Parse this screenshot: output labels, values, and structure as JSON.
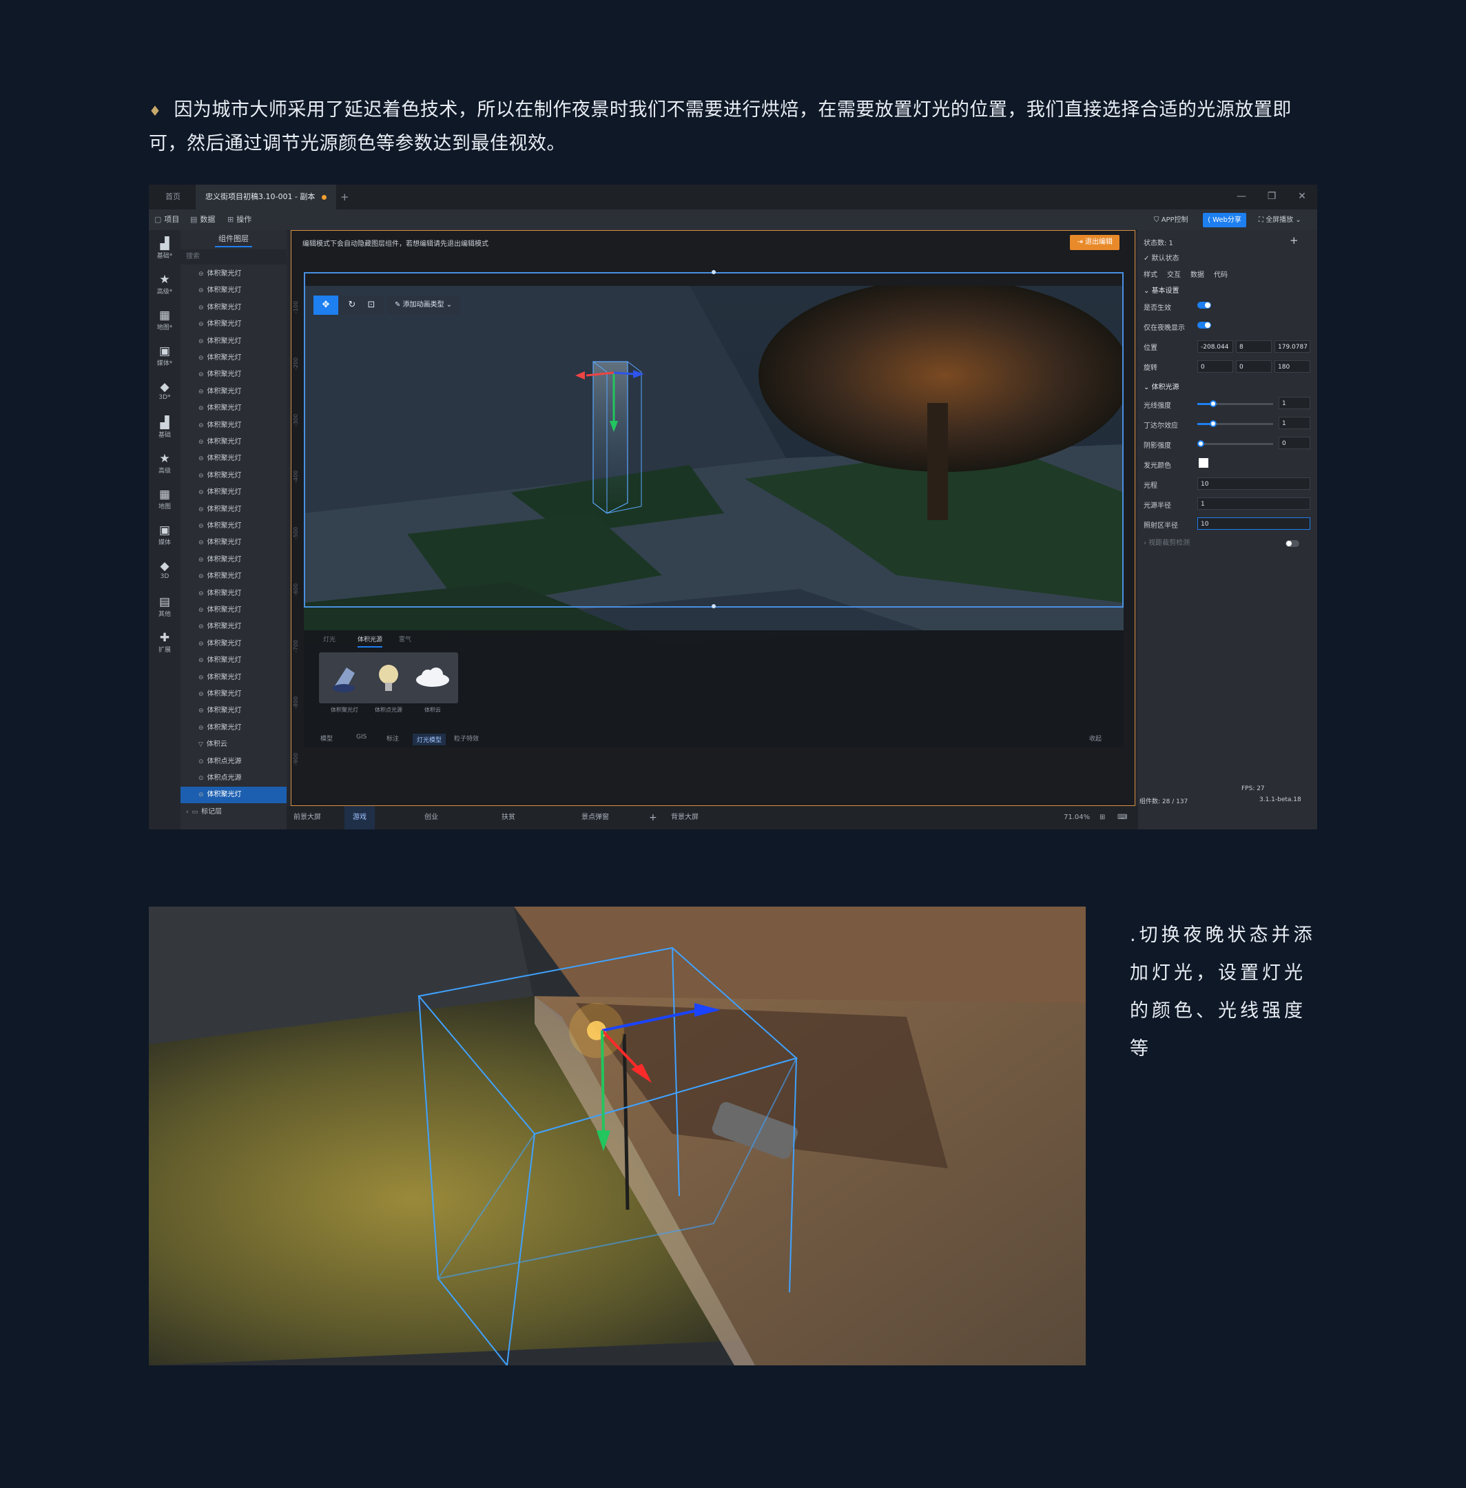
{
  "intro": {
    "bullet": "♦",
    "text": "因为城市大师采用了延迟着色技术，所以在制作夜景时我们不需要进行烘焙，在需要放置灯光的位置，我们直接选择合适的光源放置即可，然后通过调节光源颜色等参数达到最佳视效。"
  },
  "app": {
    "tabs": [
      {
        "label": "首页"
      },
      {
        "label": "忠义街项目初稿3.10-001 - 副本",
        "unsaved": true
      }
    ],
    "tab_add": "+",
    "window_controls": [
      "—",
      "❐",
      "✕"
    ],
    "menu": [
      {
        "icon": "project-icon",
        "label": "项目"
      },
      {
        "icon": "data-icon",
        "label": "数据"
      },
      {
        "icon": "operate-icon",
        "label": "操作"
      }
    ],
    "top_buttons": {
      "app_control": "APP控制",
      "web_share": "Web分享",
      "fullscreen": "全屏播放"
    },
    "iconbar": [
      {
        "label": "基础*",
        "icon": "chart-icon"
      },
      {
        "label": "高级*",
        "icon": "star-icon"
      },
      {
        "label": "地图*",
        "icon": "map-icon"
      },
      {
        "label": "媒体*",
        "icon": "media-icon"
      },
      {
        "label": "3D*",
        "icon": "cube-icon"
      },
      {
        "label": "基础",
        "icon": "chart-icon"
      },
      {
        "label": "高级",
        "icon": "star-icon"
      },
      {
        "label": "地图",
        "icon": "map-icon"
      },
      {
        "label": "媒体",
        "icon": "media-icon"
      },
      {
        "label": "3D",
        "icon": "cube-icon"
      },
      {
        "label": "其他",
        "icon": "other-icon"
      },
      {
        "label": "扩展",
        "icon": "puzzle-icon"
      }
    ],
    "layers": {
      "header": "组件图层",
      "search_placeholder": "搜索",
      "items": [
        "体积聚光灯",
        "体积聚光灯",
        "体积聚光灯",
        "体积聚光灯",
        "体积聚光灯",
        "体积聚光灯",
        "体积聚光灯",
        "体积聚光灯",
        "体积聚光灯",
        "体积聚光灯",
        "体积聚光灯",
        "体积聚光灯",
        "体积聚光灯",
        "体积聚光灯",
        "体积聚光灯",
        "体积聚光灯",
        "体积聚光灯",
        "体积聚光灯",
        "体积聚光灯",
        "体积聚光灯",
        "体积聚光灯",
        "体积聚光灯",
        "体积聚光灯",
        "体积聚光灯",
        "体积聚光灯",
        "体积聚光灯",
        "体积聚光灯",
        "体积聚光灯"
      ],
      "extra_items": [
        "体积云",
        "体积点光源",
        "体积点光源"
      ],
      "selected": "体积聚光灯",
      "group": "标记层"
    },
    "viewport": {
      "message": "编辑模式下会自动隐藏图层组件，若想编辑请先退出编辑模式",
      "exit_button": "退出编辑",
      "anim_dropdown": "添加动画类型",
      "ruler_marks": [
        "-100",
        "-200",
        "-300",
        "-400",
        "-500",
        "-600",
        "-700",
        "-800",
        "-900"
      ],
      "panel_tabs": [
        "灯光",
        "体积光源",
        "雾气"
      ],
      "thumbs": [
        "体积聚光灯",
        "体积点光源",
        "体积云"
      ],
      "bottom_tabs": [
        "模型",
        "GIS",
        "标注",
        "灯光模型",
        "粒子特效"
      ],
      "bottom_right": "收起"
    },
    "props": {
      "state_count": "状态数: 1",
      "state_name": "默认状态",
      "tabs": [
        "样式",
        "交互",
        "数据",
        "代码"
      ],
      "sec_basic": "基本设置",
      "effect_label": "是否生效",
      "night_label": "仅在夜晚显示",
      "pos_label": "位置",
      "pos": [
        "-208.044",
        "8",
        "179.0787"
      ],
      "rot_label": "旋转",
      "rot": [
        "0",
        "0",
        "180"
      ],
      "sec_light": "体积光源",
      "intensity_label": "光线强度",
      "intensity": "1",
      "tyndall_label": "丁达尔效应",
      "tyndall": "1",
      "shadow_label": "阴影强度",
      "shadow": "0",
      "color_label": "发光颜色",
      "range_label": "光程",
      "range": "10",
      "radius_label": "光源半径",
      "radius": "1",
      "area_label": "照射区半径",
      "area": "10",
      "sec_collapsed": "视距裁剪检测"
    },
    "statusbar": {
      "screens": [
        "前景大屏",
        "游戏",
        "创业",
        "扶贫",
        "景点弹窗"
      ],
      "add": "+",
      "bg_screen": "背景大屏",
      "zoom": "71.04%",
      "fps": "FPS: 27",
      "comp_count": "组件数: 28 / 137",
      "version": "3.1.1-beta.18"
    }
  },
  "caption2": ".切换夜晚状态并添加灯光，设置灯光的颜色、光线强度等",
  "colors": {
    "accent": "#1d7ff0",
    "warn": "#e98a2a",
    "bg": "#0f1826"
  }
}
